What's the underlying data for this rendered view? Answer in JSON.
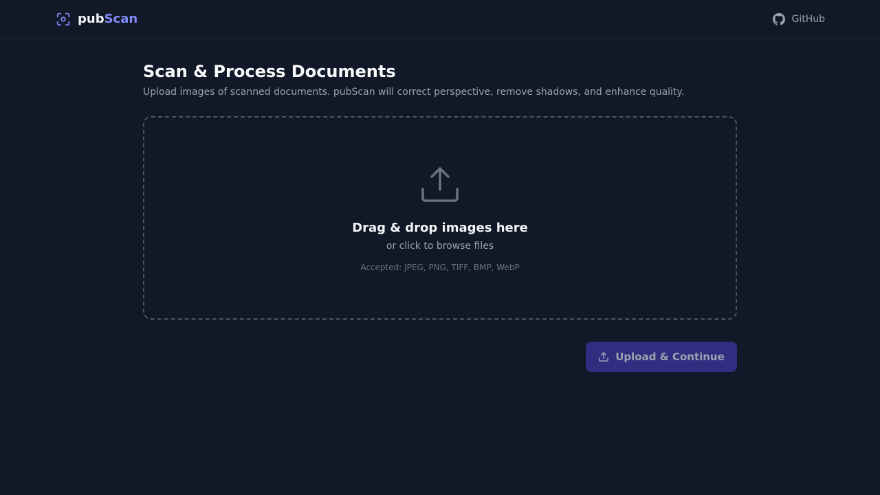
{
  "header": {
    "brand_part1": "pub",
    "brand_part2": "Scan",
    "github_label": "GitHub"
  },
  "main": {
    "title": "Scan & Process Documents",
    "subtitle": "Upload images of scanned documents. pubScan will correct perspective, remove shadows, and enhance quality."
  },
  "dropzone": {
    "title": "Drag & drop images here",
    "subtitle": "or click to browse files",
    "accepted": "Accepted: JPEG, PNG, TIFF, BMP, WebP"
  },
  "actions": {
    "submit_label": "Upload & Continue"
  },
  "icons": {
    "brand": "scan-focus-icon",
    "github": "github-icon",
    "dropzone": "upload-icon",
    "button": "upload-icon"
  },
  "colors": {
    "background": "#111827",
    "accent": "#818cf8",
    "button_bg": "#312e81",
    "muted_text": "#9ca3af"
  }
}
